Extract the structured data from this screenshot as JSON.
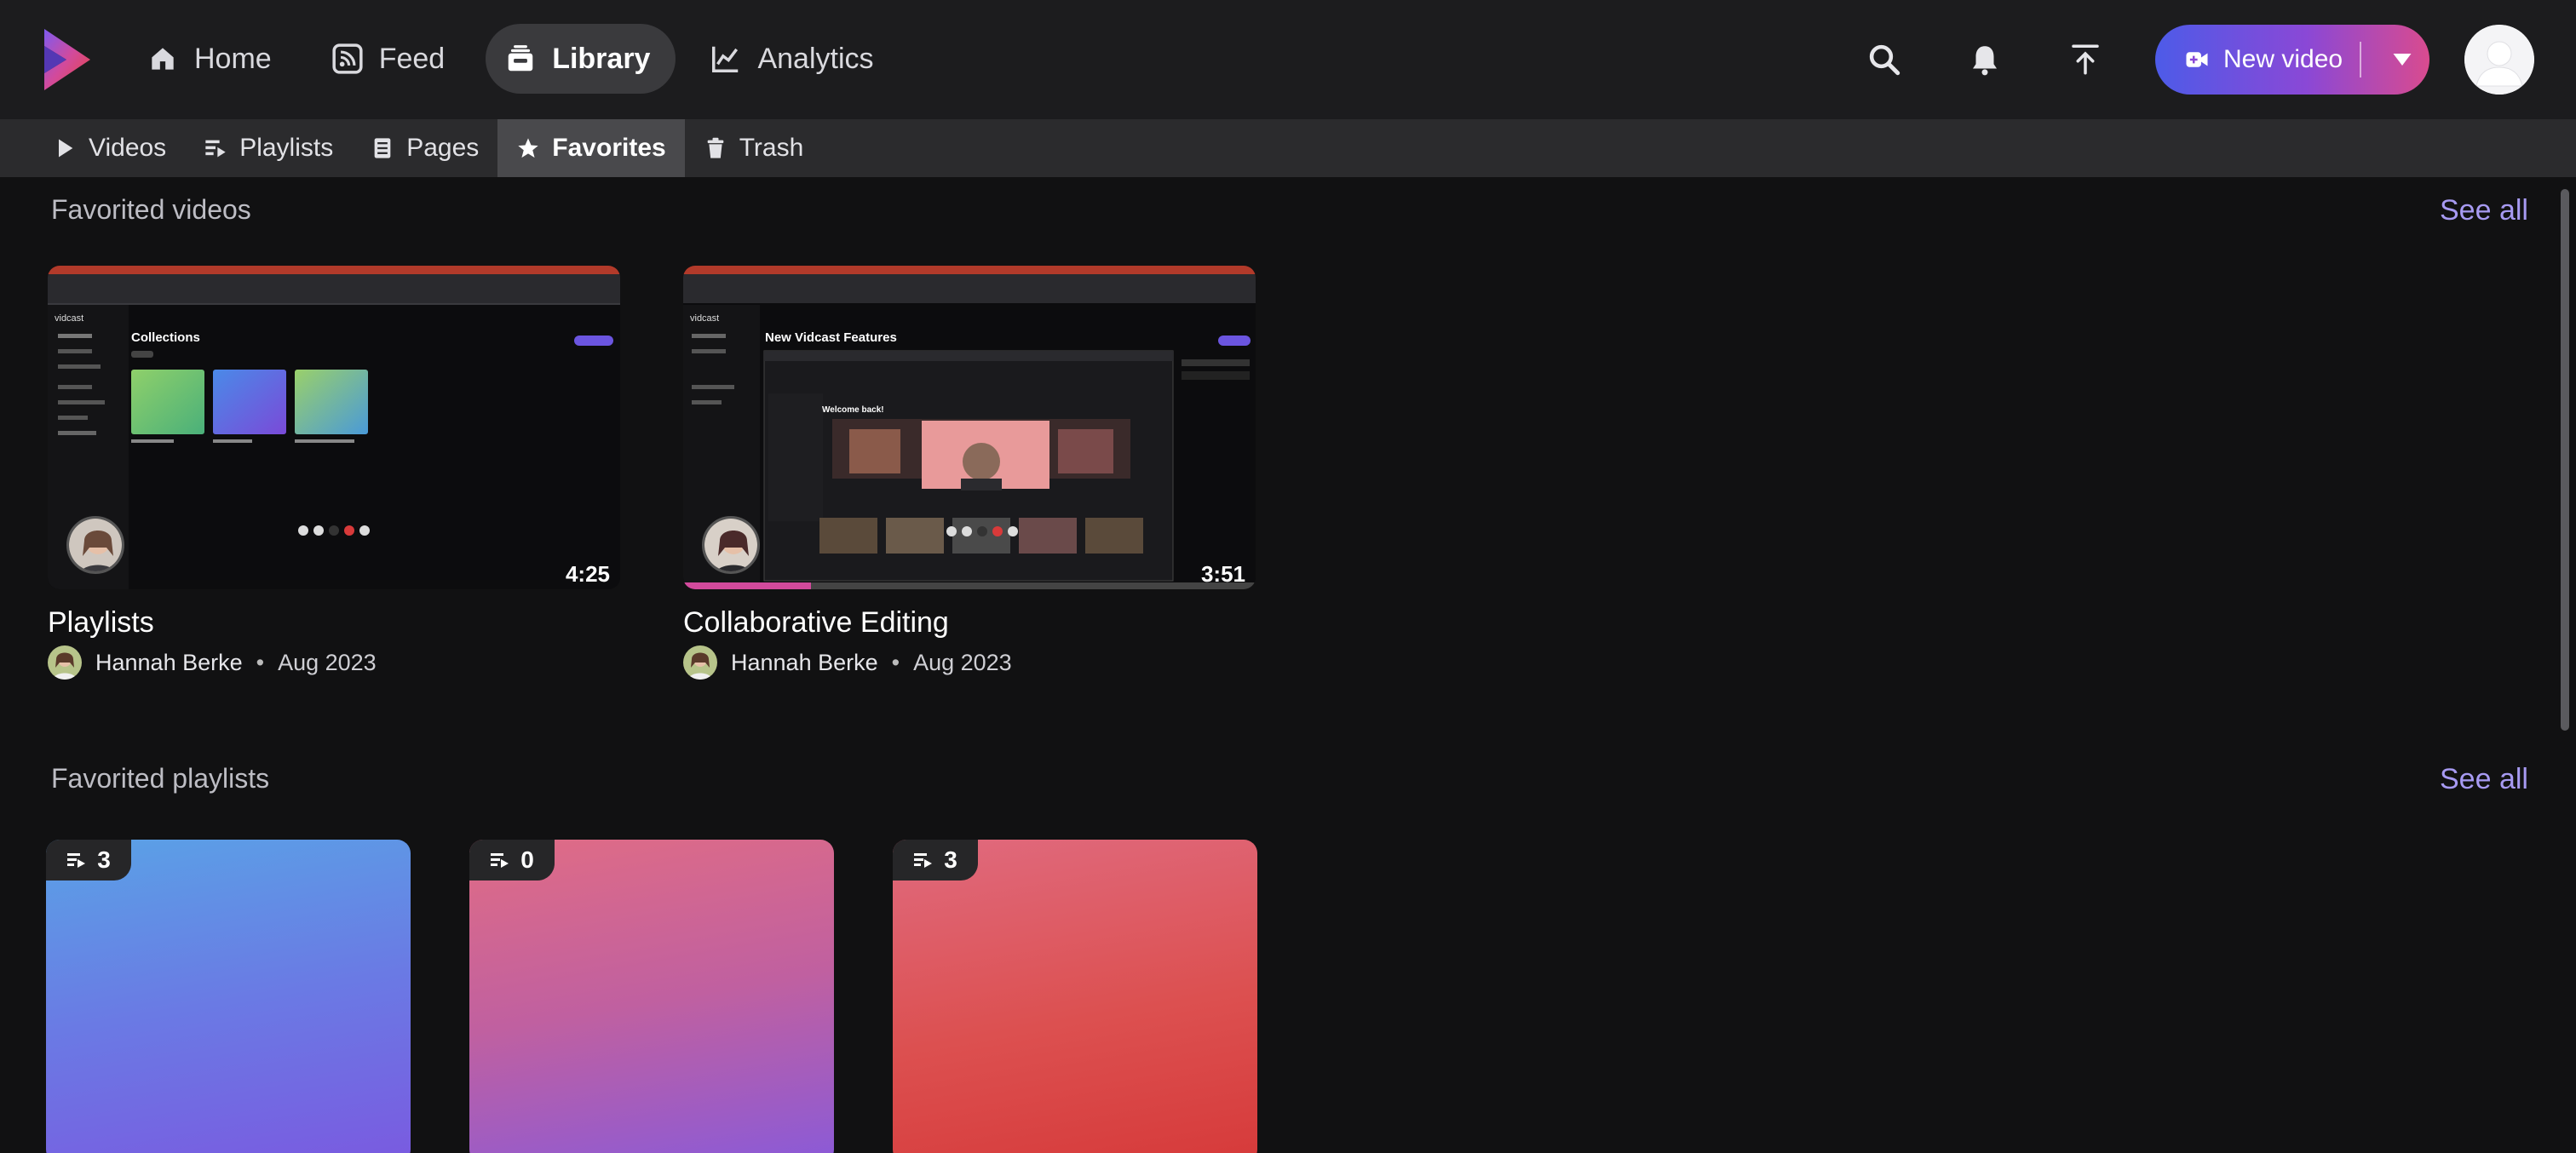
{
  "nav": {
    "items": [
      {
        "label": "Home",
        "icon": "home-icon"
      },
      {
        "label": "Feed",
        "icon": "rss-icon"
      },
      {
        "label": "Library",
        "icon": "library-icon",
        "active": true
      },
      {
        "label": "Analytics",
        "icon": "chart-icon"
      }
    ]
  },
  "header": {
    "new_video_label": "New video",
    "new_video_gradient": [
      "#4d5be8",
      "#d94b8f"
    ]
  },
  "subtabs": [
    {
      "label": "Videos",
      "icon": "play-icon"
    },
    {
      "label": "Playlists",
      "icon": "playlist-icon"
    },
    {
      "label": "Pages",
      "icon": "page-icon"
    },
    {
      "label": "Favorites",
      "icon": "star-icon",
      "active": true
    },
    {
      "label": "Trash",
      "icon": "trash-icon"
    }
  ],
  "favorited_videos": {
    "title": "Favorited videos",
    "see_all": "See all",
    "items": [
      {
        "title": "Playlists",
        "author": "Hannah Berke",
        "date": "Aug 2023",
        "duration": "4:25",
        "thumb_heading": "Collections",
        "thumb_app": "vidcast"
      },
      {
        "title": "Collaborative Editing",
        "author": "Hannah Berke",
        "date": "Aug 2023",
        "duration": "3:51",
        "thumb_heading": "New Vidcast Features",
        "thumb_app": "vidcast",
        "thumb_sub": "Welcome back!"
      }
    ]
  },
  "favorited_playlists": {
    "title": "Favorited playlists",
    "see_all": "See all",
    "items": [
      {
        "count": "3",
        "gradient": [
          "#5aa2e6",
          "#7a5ae0"
        ]
      },
      {
        "count": "0",
        "gradient": [
          "#e06c85",
          "#8a5ad8"
        ]
      },
      {
        "count": "3",
        "gradient": [
          "#e06a7e",
          "#d63a3a"
        ]
      }
    ]
  },
  "colors": {
    "accent": "#a79af2",
    "background": "#111112",
    "topbar": "#1c1c1e"
  }
}
